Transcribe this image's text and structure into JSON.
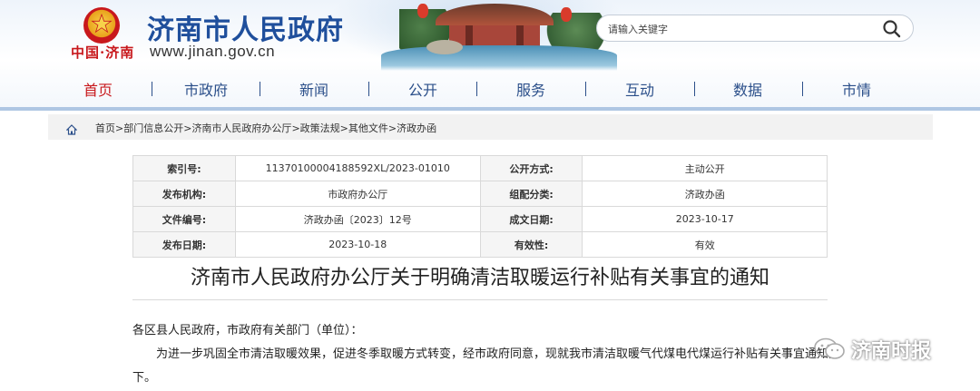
{
  "header": {
    "site_title": "济南市人民政府",
    "site_url": "www.jinan.gov.cn",
    "brand_mark": "中国·济南",
    "search": {
      "placeholder": "请输入关键字"
    }
  },
  "nav": {
    "items": [
      {
        "label": "首页",
        "active": true
      },
      {
        "label": "市政府"
      },
      {
        "label": "新闻"
      },
      {
        "label": "公开"
      },
      {
        "label": "服务"
      },
      {
        "label": "互动"
      },
      {
        "label": "数据"
      },
      {
        "label": "市情"
      }
    ]
  },
  "breadcrumb": {
    "items": [
      "首页",
      "部门信息公开",
      "济南市人民政府办公厅",
      "政策法规",
      "其他文件",
      "济政办函"
    ],
    "separator": ">"
  },
  "meta": {
    "rows": [
      {
        "k1": "索引号:",
        "v1": "11370100004188592XL/2023-01010",
        "k2": "公开方式:",
        "v2": "主动公开"
      },
      {
        "k1": "发布机构:",
        "v1": "市政府办公厅",
        "k2": "组配分类:",
        "v2": "济政办函"
      },
      {
        "k1": "文件编号:",
        "v1": "济政办函〔2023〕12号",
        "k2": "成文日期:",
        "v2": "2023-10-17"
      },
      {
        "k1": "发布日期:",
        "v1": "2023-10-18",
        "k2": "有效性:",
        "v2": "有效"
      }
    ]
  },
  "document": {
    "title": "济南市人民政府办公厅关于明确清洁取暖运行补贴有关事宜的通知",
    "salutation": "各区县人民政府，市政府有关部门（单位）：",
    "body_line1": "为进一步巩固全市清洁取暖效果，促进冬季取暖方式转变，经市政府同意，现就我市清洁取暖气代煤电代煤运行补贴有关事宜通知如",
    "body_line2": "下。"
  },
  "watermark": {
    "text": "济南时报"
  }
}
